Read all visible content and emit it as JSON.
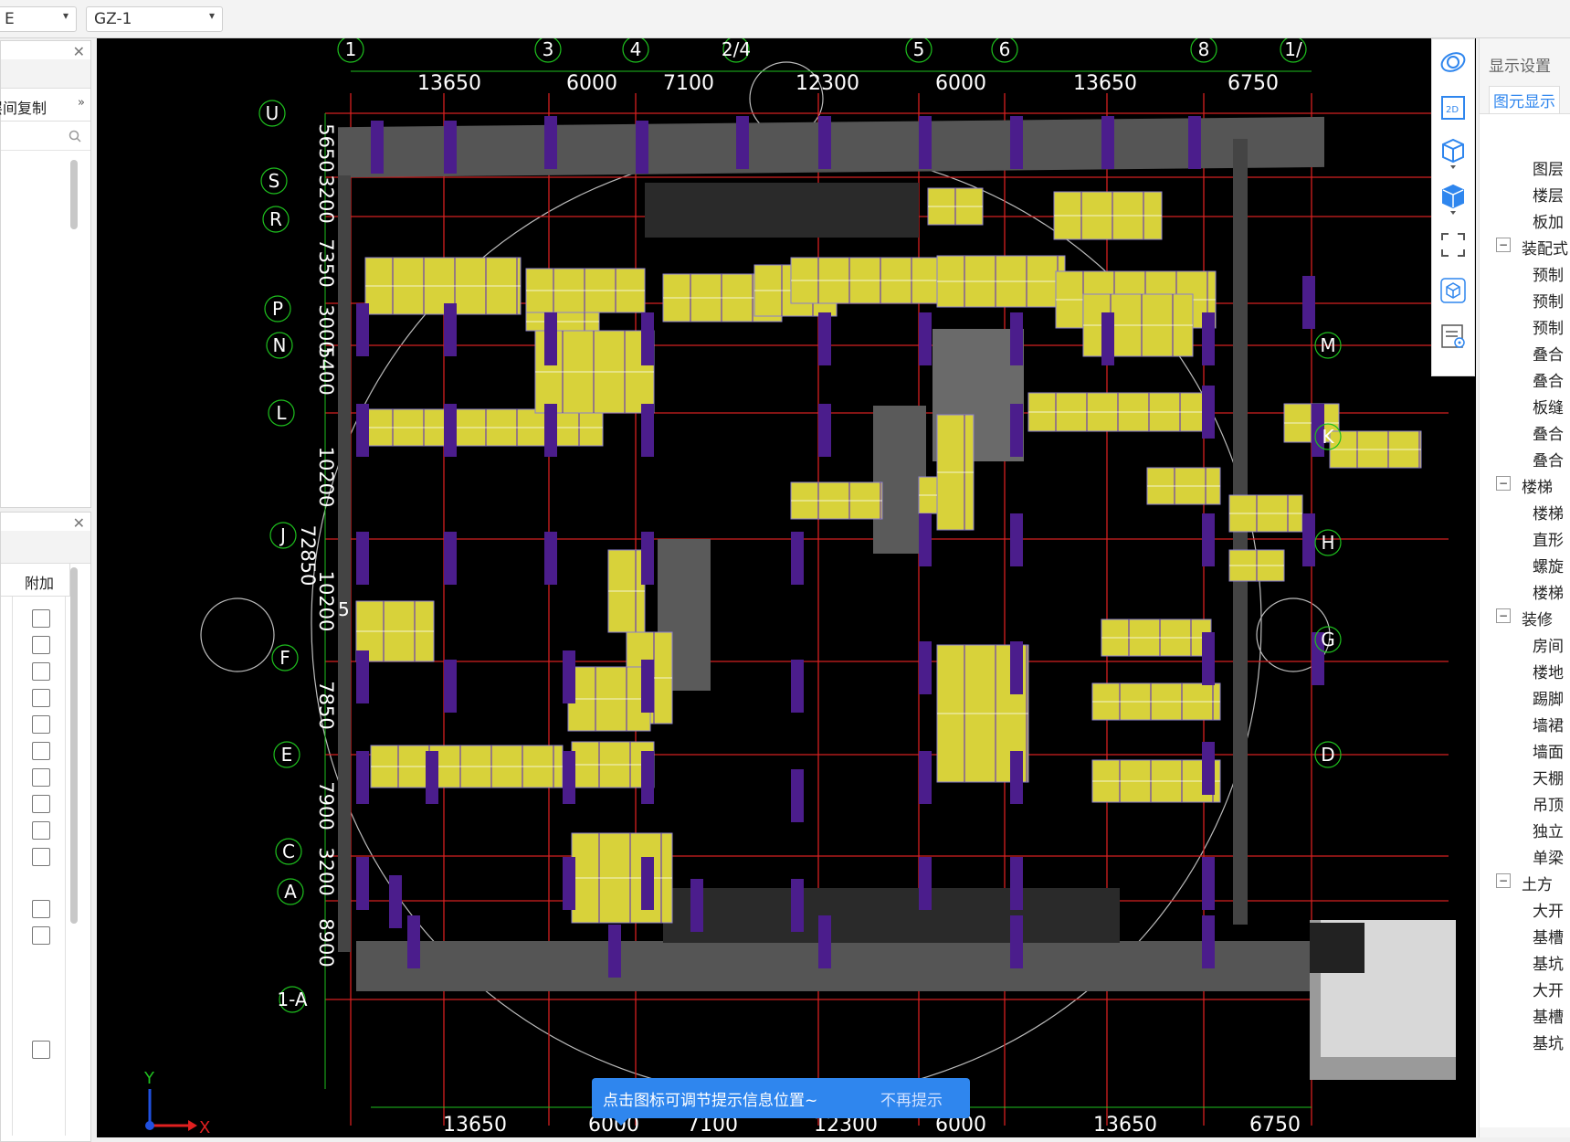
{
  "toolbar": {
    "combo1": {
      "value": "E"
    },
    "combo2": {
      "value": "GZ-1"
    }
  },
  "left_panel_top": {
    "action_label": "层间复制",
    "more": "»"
  },
  "left_panel_bottom": {
    "column_header": "附加"
  },
  "canvas": {
    "top_axis_labels": [
      "1",
      "3",
      "4",
      "2/4",
      "5",
      "6",
      "8",
      "1/"
    ],
    "top_dims": [
      "13650",
      "6000",
      "7100",
      "12300",
      "6000",
      "13650",
      "6750"
    ],
    "left_axis_labels": [
      "U",
      "S",
      "R",
      "P",
      "N",
      "L",
      "J",
      "F",
      "E",
      "C",
      "A",
      "1-A"
    ],
    "left_dims": [
      "5650",
      "3200",
      "7350",
      "3000",
      "5400",
      "10200",
      "72850",
      "10200",
      "7850",
      "7900",
      "3200",
      "8900"
    ],
    "right_axis_labels": [
      "M",
      "K",
      "H",
      "G",
      "D"
    ],
    "bottom_dims": [
      "13650",
      "6000",
      "7100",
      "12300",
      "6000",
      "13650",
      "6750"
    ],
    "misc_label": "5",
    "axis_x": "X",
    "axis_y": "Y"
  },
  "view_tools": [
    "orbit-icon",
    "2d-icon",
    "3d-box-icon",
    "3d-solid-icon",
    "fit-view-icon",
    "cube-icon",
    "display-settings-icon"
  ],
  "right_panel": {
    "title": "显示设置",
    "tab": "图元显示",
    "rows": [
      {
        "label": "图层",
        "indent": 2,
        "expander": false
      },
      {
        "label": "楼层",
        "indent": 2,
        "expander": false
      },
      {
        "label": "板加",
        "indent": 2,
        "expander": false
      },
      {
        "label": "装配式",
        "indent": 1,
        "expander": true
      },
      {
        "label": "预制",
        "indent": 2,
        "expander": false
      },
      {
        "label": "预制",
        "indent": 2,
        "expander": false
      },
      {
        "label": "预制",
        "indent": 2,
        "expander": false
      },
      {
        "label": "叠合",
        "indent": 2,
        "expander": false
      },
      {
        "label": "叠合",
        "indent": 2,
        "expander": false
      },
      {
        "label": "板缝",
        "indent": 2,
        "expander": false
      },
      {
        "label": "叠合",
        "indent": 2,
        "expander": false
      },
      {
        "label": "叠合",
        "indent": 2,
        "expander": false
      },
      {
        "label": "楼梯",
        "indent": 1,
        "expander": true
      },
      {
        "label": "楼梯",
        "indent": 2,
        "expander": false
      },
      {
        "label": "直形",
        "indent": 2,
        "expander": false
      },
      {
        "label": "螺旋",
        "indent": 2,
        "expander": false
      },
      {
        "label": "楼梯",
        "indent": 2,
        "expander": false
      },
      {
        "label": "装修",
        "indent": 1,
        "expander": true
      },
      {
        "label": "房间",
        "indent": 2,
        "expander": false
      },
      {
        "label": "楼地",
        "indent": 2,
        "expander": false
      },
      {
        "label": "踢脚",
        "indent": 2,
        "expander": false
      },
      {
        "label": "墙裙",
        "indent": 2,
        "expander": false
      },
      {
        "label": "墙面",
        "indent": 2,
        "expander": false
      },
      {
        "label": "天棚",
        "indent": 2,
        "expander": false
      },
      {
        "label": "吊顶",
        "indent": 2,
        "expander": false
      },
      {
        "label": "独立",
        "indent": 2,
        "expander": false
      },
      {
        "label": "单梁",
        "indent": 2,
        "expander": false
      },
      {
        "label": "土方",
        "indent": 1,
        "expander": true
      },
      {
        "label": "大开",
        "indent": 2,
        "expander": false
      },
      {
        "label": "基槽",
        "indent": 2,
        "expander": false
      },
      {
        "label": "基坑",
        "indent": 2,
        "expander": false
      },
      {
        "label": "大开",
        "indent": 2,
        "expander": false
      },
      {
        "label": "基槽",
        "indent": 2,
        "expander": false
      },
      {
        "label": "基坑",
        "indent": 2,
        "expander": false
      }
    ]
  },
  "toast": {
    "message": "点击图标可调节提示信息位置~",
    "dismiss": "不再提示"
  },
  "colors": {
    "background": "#000000",
    "slab": "#d8d23a",
    "column": "#4b1d8c",
    "grid": "#d42020",
    "axis_text": "#ffffff",
    "dim_line": "#1ec01e",
    "wall": "#555555"
  }
}
